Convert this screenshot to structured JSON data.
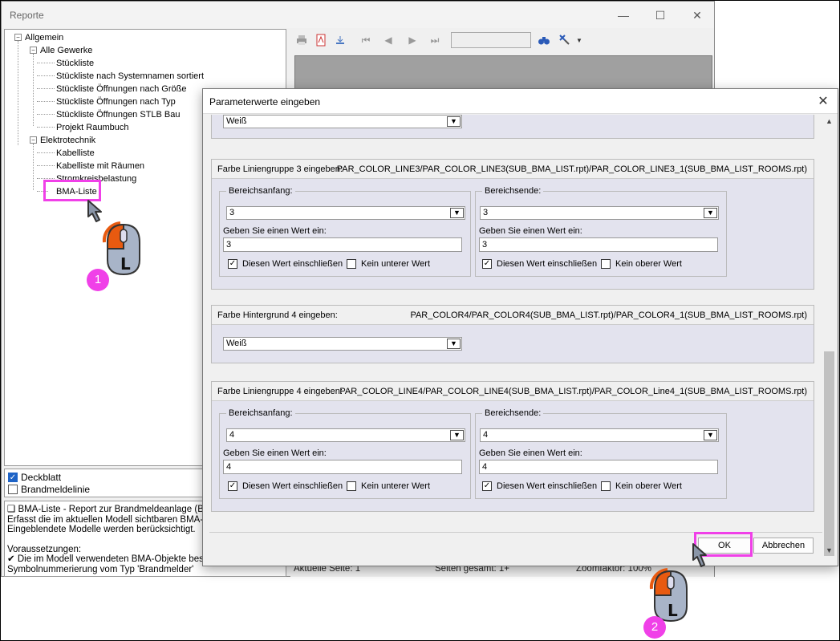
{
  "main_window": {
    "title": "Reporte",
    "controls": [
      "—",
      "☐",
      "✕"
    ]
  },
  "tree": {
    "root": "Allgemein",
    "groups": [
      {
        "label": "Alle Gewerke",
        "items": [
          "Stückliste",
          "Stückliste nach Systemnamen sortiert",
          "Stückliste Öffnungen nach Größe",
          "Stückliste Öffnungen nach Typ",
          "Stückliste Öffnungen STLB Bau",
          "Projekt Raumbuch"
        ]
      },
      {
        "label": "Elektrotechnik",
        "items": [
          "Kabelliste",
          "Kabelliste mit Räumen",
          "Stromkreisbelastung",
          "BMA-Liste"
        ]
      }
    ]
  },
  "options": [
    {
      "label": "Deckblatt",
      "checked": true
    },
    {
      "label": "Brandmeldelinie",
      "checked": false
    }
  ],
  "description": {
    "lines": [
      "❑ BMA-Liste - Report zur Brandmeldeanlage (BMA)",
      "Erfasst die im aktuellen Modell sichtbaren BMA-Obje",
      "Eingeblendete Modelle werden berücksichtigt.",
      "",
      "Voraussetzungen:",
      "✔ Die im Modell verwendeten BMA-Objekte besitze",
      "Symbolnummerierung vom Typ 'Brandmelder'"
    ]
  },
  "status_bar": {
    "page": "Aktuelle Seite: 1",
    "total": "Seiten gesamt: 1+",
    "zoom": "Zoomfaktor: 100%"
  },
  "dialog": {
    "title": "Parameterwerte eingeben",
    "close": "✕",
    "top_select": "Weiß",
    "groups": [
      {
        "label": "Farbe Liniengruppe 3 eingeben:",
        "param": "PAR_COLOR_LINE3/PAR_COLOR_LINE3(SUB_BMA_LIST.rpt)/PAR_COLOR_LINE3_1(SUB_BMA_LIST_ROOMS.rpt)",
        "start": {
          "legend": "Bereichsanfang:",
          "select": "3",
          "prompt": "Geben Sie einen Wert ein:",
          "value": "3",
          "include": "Diesen Wert einschließen",
          "none": "Kein unterer Wert"
        },
        "end": {
          "legend": "Bereichsende:",
          "select": "3",
          "prompt": "Geben Sie einen Wert ein:",
          "value": "3",
          "include": "Diesen Wert einschließen",
          "none": "Kein oberer Wert"
        }
      },
      {
        "label": "Farbe Hintergrund 4 eingeben:",
        "param": "PAR_COLOR4/PAR_COLOR4(SUB_BMA_LIST.rpt)/PAR_COLOR4_1(SUB_BMA_LIST_ROOMS.rpt)",
        "select": "Weiß"
      },
      {
        "label": "Farbe Liniengruppe 4 eingeben:",
        "param": "PAR_COLOR_LINE4/PAR_COLOR_LINE4(SUB_BMA_LIST.rpt)/PAR_COLOR_Line4_1(SUB_BMA_LIST_ROOMS.rpt)",
        "start": {
          "legend": "Bereichsanfang:",
          "select": "4",
          "prompt": "Geben Sie einen Wert ein:",
          "value": "4",
          "include": "Diesen Wert einschließen",
          "none": "Kein unterer Wert"
        },
        "end": {
          "legend": "Bereichsende:",
          "select": "4",
          "prompt": "Geben Sie einen Wert ein:",
          "value": "4",
          "include": "Diesen Wert einschließen",
          "none": "Kein oberer Wert"
        }
      }
    ],
    "ok": "OK",
    "cancel": "Abbrechen"
  },
  "annotations": {
    "step1": "1",
    "step2": "2",
    "mouse_letter": "L",
    "highlight_color": "#f040e8"
  }
}
